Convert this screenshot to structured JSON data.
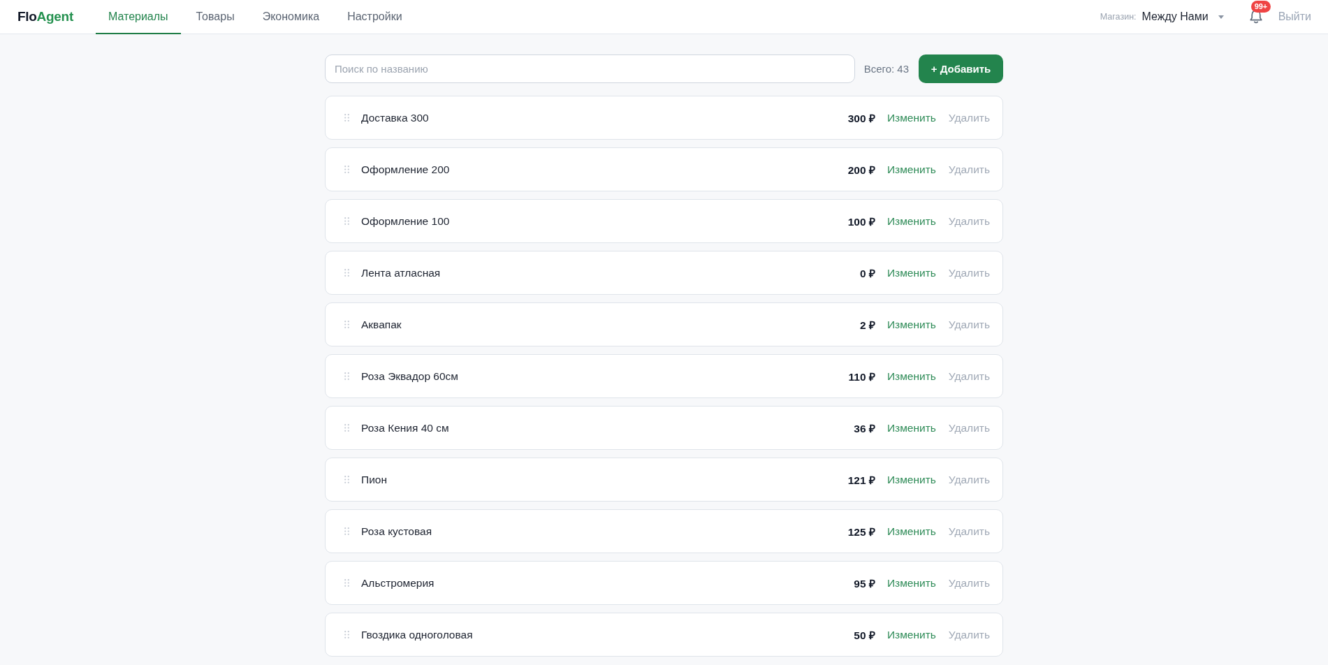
{
  "header": {
    "logo": [
      {
        "text": "Flo",
        "kind": "plain"
      },
      {
        "text": "Agent",
        "kind": "accent"
      }
    ],
    "tabs": [
      {
        "label": "Материалы",
        "selected": true
      },
      {
        "label": "Товары",
        "selected": false
      },
      {
        "label": "Экономика",
        "selected": false
      },
      {
        "label": "Настройки",
        "selected": false
      }
    ],
    "store": {
      "label": "Магазин:",
      "value": "Между Нами"
    },
    "notifications": {
      "badge": "99+"
    },
    "logout": "Выйти"
  },
  "toolbar": {
    "search": {
      "placeholder": "Поиск по названию"
    },
    "total": "Всего: 43",
    "add_button": "+ Добавить"
  },
  "materials": [
    {
      "name": "Доставка 300",
      "price": "300 ₽",
      "edit": "Изменить",
      "delete": "Удалить"
    },
    {
      "name": "Оформление 200",
      "price": "200 ₽",
      "edit": "Изменить",
      "delete": "Удалить"
    },
    {
      "name": "Оформление 100",
      "price": "100 ₽",
      "edit": "Изменить",
      "delete": "Удалить"
    },
    {
      "name": "Лента атласная",
      "price": "0 ₽",
      "edit": "Изменить",
      "delete": "Удалить"
    },
    {
      "name": "Аквапак",
      "price": "2 ₽",
      "edit": "Изменить",
      "delete": "Удалить"
    },
    {
      "name": "Роза Эквадор 60см",
      "price": "110 ₽",
      "edit": "Изменить",
      "delete": "Удалить"
    },
    {
      "name": "Роза Кения 40 см",
      "price": "36 ₽",
      "edit": "Изменить",
      "delete": "Удалить"
    },
    {
      "name": "Пион",
      "price": "121 ₽",
      "edit": "Изменить",
      "delete": "Удалить"
    },
    {
      "name": "Роза кустовая",
      "price": "125 ₽",
      "edit": "Изменить",
      "delete": "Удалить"
    },
    {
      "name": "Альстромерия",
      "price": "95 ₽",
      "edit": "Изменить",
      "delete": "Удалить"
    },
    {
      "name": "Гвоздика одноголовая",
      "price": "50 ₽",
      "edit": "Изменить",
      "delete": "Удалить"
    }
  ]
}
